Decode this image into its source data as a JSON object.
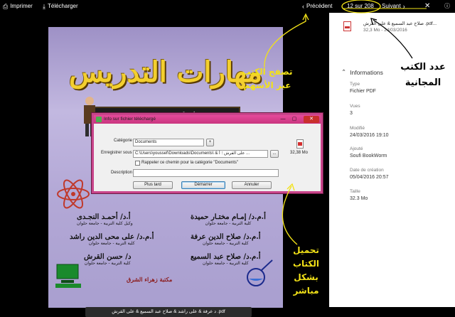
{
  "toolbar": {
    "print_label": "Imprimer",
    "download_label": "Télécharger",
    "prev_label": "Précédent",
    "page_indicator": "12 sur 208",
    "next_label": "Suivant"
  },
  "cover": {
    "title": "مهارات التدريس",
    "board_formula": "995 ² √×249 51",
    "author1": "أ.د/ أحمـد النجـدى",
    "author1_sub": "وكيل كلية التربية - جامعة حلوان",
    "author2": "أ.م.د/ إمـام مختـار حميدة",
    "author2_sub": "كلية التربية - جامعة حلوان",
    "author3": "أ.م.د/ على محى الدين راشد",
    "author3_sub": "كلية التربية - جامعة حلوان",
    "author4": "أ.م.د/ صلاح الدين عرفة",
    "author4_sub": "كلية التربية - جامعة حلوان",
    "author5": "د/ حسن القرش",
    "author5_sub": "كلية التربية - جامعة حلوان",
    "author6": "أ.م.د/ صلاح عبد السميع",
    "author6_sub": "كلية التربية - جامعة حلوان",
    "publisher": "مكتبة زهراء الشرق",
    "caption": "د عرفة & على راشد & صلاح عبد السميع & على القرش .pdf"
  },
  "sidebar": {
    "file_name": "صلاح عبد السميع & على القرش .pdf...",
    "file_meta": "32,3 Mo - 24/03/2016",
    "info_title": "Informations",
    "fields": [
      {
        "label": "Type",
        "value": "Fichier PDF"
      },
      {
        "label": "Vues",
        "value": "3"
      },
      {
        "label": "Modifié",
        "value": "24/03/2016 19:10"
      },
      {
        "label": "Ajouté",
        "value": "Soufi BookWorm"
      },
      {
        "label": "Date de création",
        "value": "05/04/2016 20:57"
      },
      {
        "label": "Taille",
        "value": "32.3 Mo"
      }
    ]
  },
  "dialog": {
    "title": "Info sur fichier téléchargé",
    "category_label": "Catégorie",
    "category_value": "Documents",
    "add_button": "+",
    "save_label": "Enregistrer sous",
    "save_path": "C:\\Users\\youssef\\Downloads\\Documents\\ & على القرش ؛ أ ...",
    "browse_button": "...",
    "remember_label": "Rappeler ce chemin pour la catégorie \"Documents\"",
    "description_label": "Description",
    "file_size": "32,38 Mo",
    "later_button": "Plus tard",
    "start_button": "Démarrer",
    "cancel_button": "Annuler",
    "min_glyph": "—",
    "max_glyph": "▢",
    "close_glyph": "✕"
  },
  "annotations": {
    "browse_arrows": "تصفح الكتب عبر الأسهم",
    "free_books_count": "عدد الكتب المجانية",
    "direct_download": "تحميل الكتاب بشكل مباشر"
  },
  "colors": {
    "annotation_yellow": "#f2e218",
    "dialog_border": "#c8448a",
    "cover_title": "#f3cf2f"
  }
}
